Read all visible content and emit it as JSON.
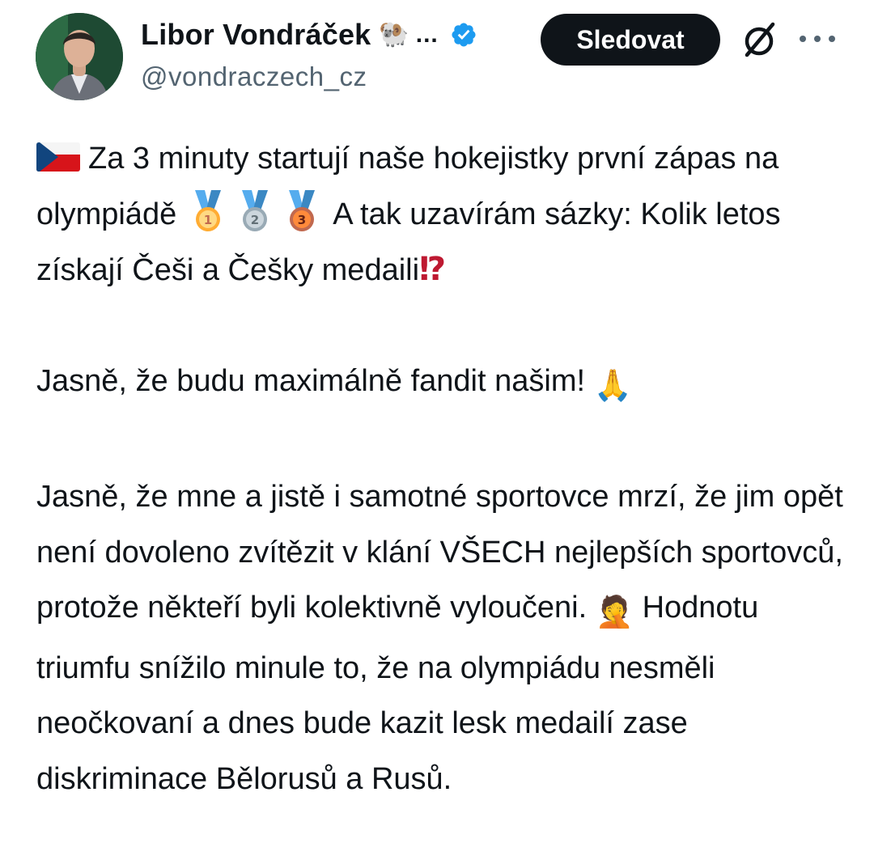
{
  "author": {
    "display_name": "Libor Vondráček",
    "name_emoji": "🐏",
    "name_ellipsis": "...",
    "handle": "@vondraczech_cz"
  },
  "actions": {
    "follow_label": "Sledovat"
  },
  "colors": {
    "follow_bg": "#0f1419",
    "verified": "#1d9bf0",
    "secondary_text": "#536471",
    "flag_red": "#d7141a",
    "flag_blue": "#11457e"
  },
  "icons": [
    "verified-badge-icon",
    "grok-icon",
    "more-options-icon",
    "czech-flag-icon",
    "gold-medal-icon",
    "silver-medal-icon",
    "bronze-medal-icon",
    "exclamation-question-icon",
    "folded-hands-icon",
    "facepalm-icon"
  ],
  "tweet": {
    "p1_a": "Za 3 minuty startují naše hokejistky první zápas na olympiádě",
    "medal_1": "1",
    "medal_2": "2",
    "medal_3": "3",
    "p1_b": " A tak uzavírám sázky: Kolik letos získají Češi a Češky medaili",
    "p1_mark": "⁉",
    "p2": "Jasně, že budu maximálně fandit našim! ",
    "p2_emoji": "🙏",
    "p3_a": "Jasně, že mne a jistě i samotné sportovce mrzí, že jim opět není dovoleno zvítězit v klání VŠECH nejlepších sportovců, protože někteří byli kolektivně vyloučeni. ",
    "p3_emoji": "🤦",
    "p3_b": " Hodnotu triumfu snížilo minule to, že na olympiádu nesměli neočkovaní a dnes bude kazit lesk medailí zase diskriminace Bělorusů a Rusů."
  }
}
